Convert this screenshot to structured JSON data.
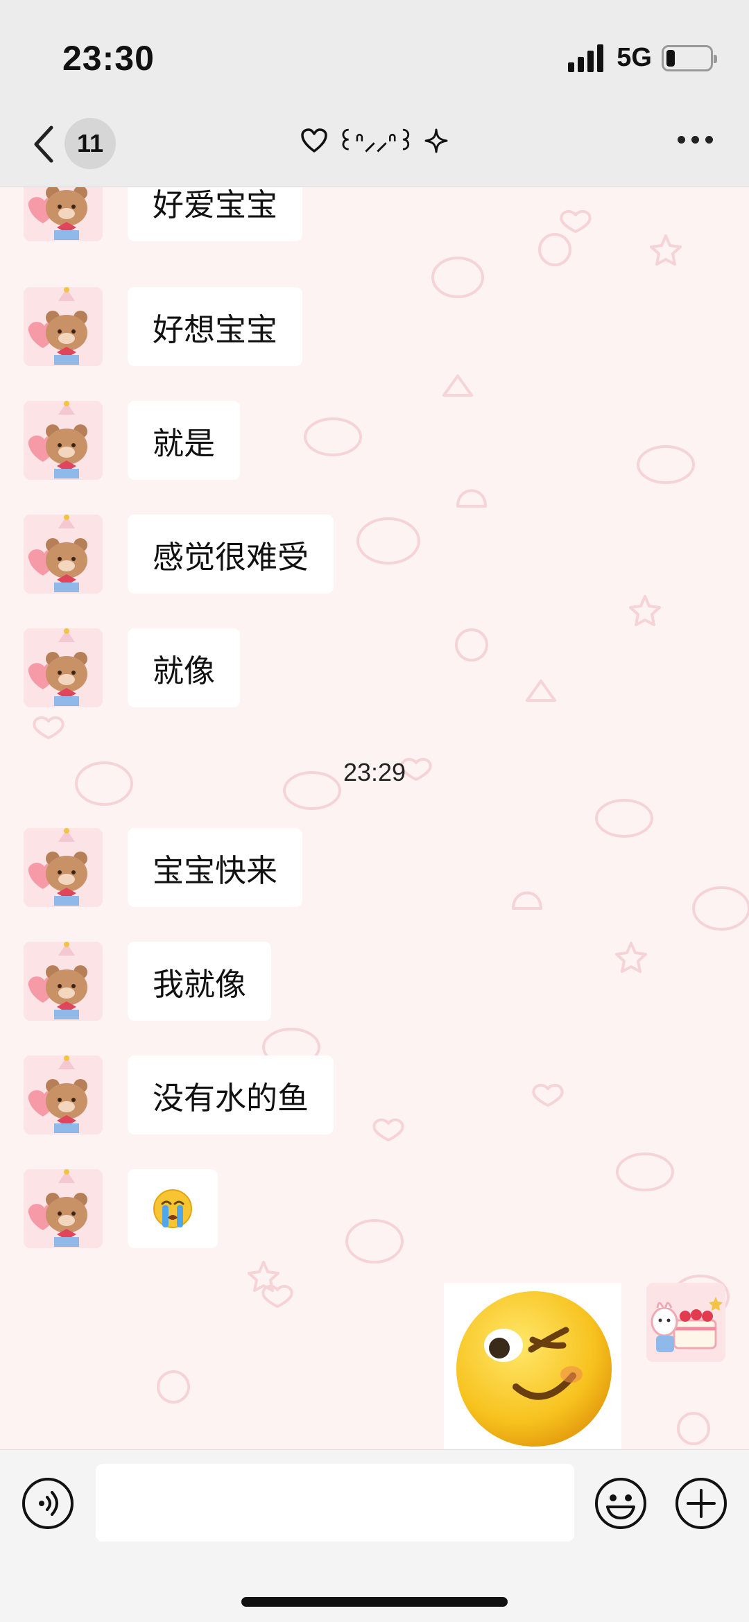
{
  "status_bar": {
    "time": "23:30",
    "network": "5G",
    "battery_level": 0.2
  },
  "header": {
    "unread_count": "11",
    "title_text": "꒰ᐢ⸝⸝ᐢ꒱",
    "back_icon": "chevron-left-icon",
    "more_icon": "ellipsis-icon",
    "title_icons": [
      "heart-outline-icon",
      "sparkle-icon"
    ]
  },
  "messages": [
    {
      "sender": "contact",
      "text": "好爱宝宝"
    },
    {
      "sender": "contact",
      "text": "好想宝宝"
    },
    {
      "sender": "contact",
      "text": "就是"
    },
    {
      "sender": "contact",
      "text": "感觉很难受"
    },
    {
      "sender": "contact",
      "text": "就像"
    },
    {
      "sender": "contact",
      "text": "宝宝快来"
    },
    {
      "sender": "contact",
      "text": "我就像"
    },
    {
      "sender": "contact",
      "text": "没有水的鱼"
    },
    {
      "sender": "contact",
      "text": "😭"
    },
    {
      "sender": "self",
      "sticker": "wink-emoji-sticker"
    }
  ],
  "time_divider": "23:29",
  "input_bar": {
    "placeholder": "",
    "value": "",
    "icons": [
      "voice-icon",
      "emoji-icon",
      "plus-icon"
    ]
  },
  "colors": {
    "chat_background": "#fdf3f3",
    "bubble": "#ffffff",
    "header": "#ececec",
    "input_bar": "#f4f4f4"
  }
}
